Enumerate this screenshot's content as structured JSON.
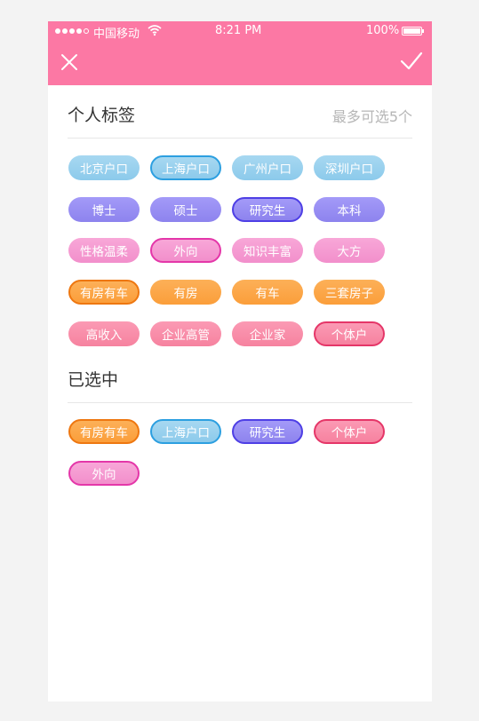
{
  "status_bar": {
    "carrier": "中国移动",
    "time": "8:21 PM",
    "battery": "100%"
  },
  "header": {
    "close_icon": "close-icon",
    "confirm_icon": "check-icon",
    "background_color": "#fc78a4"
  },
  "personal_tags": {
    "title": "个人标签",
    "limit_hint": "最多可选5个",
    "rows": [
      {
        "color": "blue",
        "tags": [
          {
            "label": "北京户口",
            "selected": false
          },
          {
            "label": "上海户口",
            "selected": true
          },
          {
            "label": "广州户口",
            "selected": false
          },
          {
            "label": "深圳户口",
            "selected": false
          }
        ]
      },
      {
        "color": "purple",
        "tags": [
          {
            "label": "博士",
            "selected": false
          },
          {
            "label": "硕士",
            "selected": false
          },
          {
            "label": "研究生",
            "selected": true
          },
          {
            "label": "本科",
            "selected": false
          }
        ]
      },
      {
        "color": "pink",
        "tags": [
          {
            "label": "性格温柔",
            "selected": false
          },
          {
            "label": "外向",
            "selected": true
          },
          {
            "label": "知识丰富",
            "selected": false
          },
          {
            "label": "大方",
            "selected": false
          }
        ]
      },
      {
        "color": "orange",
        "tags": [
          {
            "label": "有房有车",
            "selected": true
          },
          {
            "label": "有房",
            "selected": false
          },
          {
            "label": "有车",
            "selected": false
          },
          {
            "label": "三套房子",
            "selected": false
          }
        ]
      },
      {
        "color": "rose",
        "tags": [
          {
            "label": "高收入",
            "selected": false
          },
          {
            "label": "企业高管",
            "selected": false
          },
          {
            "label": "企业家",
            "selected": false
          },
          {
            "label": "个体户",
            "selected": true
          }
        ]
      }
    ]
  },
  "selected_section": {
    "title": "已选中",
    "tags": [
      {
        "label": "有房有车",
        "color": "orange"
      },
      {
        "label": "上海户口",
        "color": "blue"
      },
      {
        "label": "研究生",
        "color": "purple"
      },
      {
        "label": "个体户",
        "color": "rose"
      },
      {
        "label": "外向",
        "color": "pink"
      }
    ]
  }
}
